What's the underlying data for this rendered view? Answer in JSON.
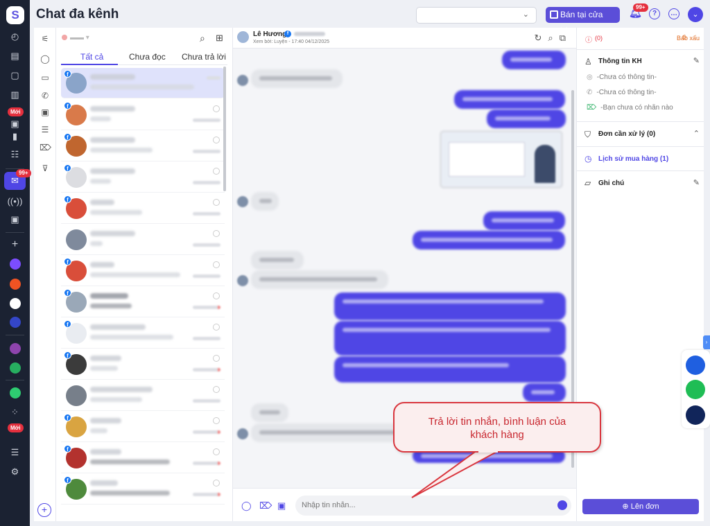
{
  "app": {
    "title": "Chat đa kênh",
    "new_badge": "Mới",
    "notif_count": "99+",
    "chat_badge": "99+"
  },
  "header": {
    "shop_button": "Bán tại cửa hàng",
    "store_select": ""
  },
  "conv_list": {
    "tabs": [
      "Tất cả",
      "Chưa đọc",
      "Chưa trả lời"
    ],
    "active_tab": 0
  },
  "chat": {
    "contact_name": "Lê Hương",
    "seen_text": "Xem bởi: Luyện - 17:40 04/12/2025",
    "composer_placeholder": "Nhập tin nhắn..."
  },
  "right_panel": {
    "report": "Báo xấu",
    "warn_count": "(0)",
    "info_title": "Thông tin KH",
    "no_info_1": "-Chưa có thông tin-",
    "no_info_2": "-Chưa có thông tin-",
    "no_tag": "-Bạn chưa có nhãn nào",
    "orders_title": "Đơn cần xử lý (0)",
    "history_title": "Lịch sử mua hàng (1)",
    "note_title": "Ghi chú",
    "create_order": "Lên đơn"
  },
  "callout": {
    "line1": "Trả lời tin nhắn, bình luận của",
    "line2": "khách hàng"
  },
  "colors": {
    "accent": "#4f46e5",
    "rail": "#1b2232",
    "facebook": "#1877f2",
    "alert": "#e5303e"
  }
}
